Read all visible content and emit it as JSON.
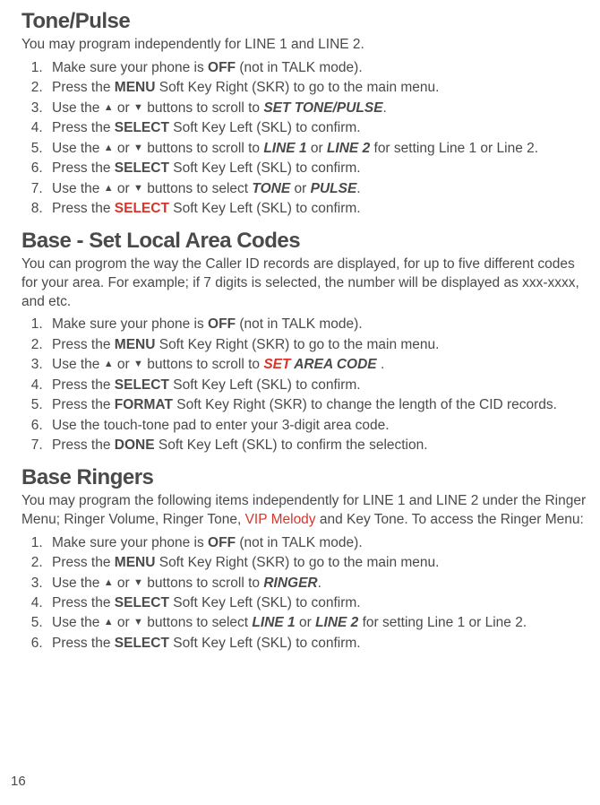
{
  "pageNumber": "16",
  "arrowUp": "▲",
  "arrowDown": "▼",
  "sections": {
    "tonePulse": {
      "title": "Tone/Pulse",
      "intro": "You may program independently for LINE  1 and LINE 2.",
      "steps": {
        "s1a": "Make sure your phone is ",
        "s1b": "OFF",
        "s1c": " (not in TALK mode).",
        "s2a": "Press the ",
        "s2b": "MENU",
        "s2c": " Soft Key Right (SKR) to go to the main menu.",
        "s3a": "Use the ",
        "s3b": " or ",
        "s3c": " buttons to scroll to ",
        "s3d": "SET TONE/PULSE",
        "s3e": ".",
        "s4a": "Press the ",
        "s4b": "SELECT",
        "s4c": " Soft Key Left (SKL) to confirm.",
        "s5a": "Use the ",
        "s5b": " or ",
        "s5c": " buttons to scroll to ",
        "s5d": "LINE 1",
        "s5e": " or ",
        "s5f": "LINE 2",
        "s5g": " for setting Line 1 or Line 2.",
        "s6a": "Press the ",
        "s6b": "SELECT",
        "s6c": " Soft Key Left (SKL) to confirm.",
        "s7a": "Use the ",
        "s7b": " or ",
        "s7c": " buttons to select ",
        "s7d": "TONE",
        "s7e": " or ",
        "s7f": "PULSE",
        "s7g": ".",
        "s8a": "Press the ",
        "s8b": "SELECT",
        "s8c": " Soft Key Left (SKL) to confirm."
      }
    },
    "areaCodes": {
      "title": "Base - Set Local Area Codes",
      "intro": "You can progrom the way the Caller ID records are displayed, for up to five different codes for your area. For example; if 7 digits is selected, the number will be displayed as xxx-xxxx, and etc.",
      "steps": {
        "s1a": "Make sure your phone is ",
        "s1b": "OFF",
        "s1c": " (not in TALK mode).",
        "s2a": "Press the ",
        "s2b": "MENU",
        "s2c": " Soft Key Right (SKR) to go to the main menu.",
        "s3a": "Use the ",
        "s3b": " or ",
        "s3c": " buttons to scroll to ",
        "s3d": "SET",
        "s3e": " AREA CODE",
        "s3f": " .",
        "s4a": "Press the ",
        "s4b": "SELECT",
        "s4c": " Soft Key Left (SKL) to confirm.",
        "s5a": "Press the ",
        "s5b": "FORMAT",
        "s5c": " Soft Key Right (SKR) to change the length of the CID records.",
        "s6": "Use the touch-tone pad to enter your 3-digit area code.",
        "s7a": "Press the ",
        "s7b": "DONE",
        "s7c": " Soft Key Left (SKL) to confirm the selection."
      }
    },
    "ringers": {
      "title": "Base Ringers",
      "introA": "You may program the following items independently for LINE  1 and LINE 2 under the Ringer Menu; Ringer Volume, Ringer Tone, ",
      "introB": "VIP Melody",
      "introC": " and Key Tone. To access the Ringer Menu:",
      "steps": {
        "s1a": "Make sure your phone is ",
        "s1b": "OFF",
        "s1c": " (not in TALK mode).",
        "s2a": "Press the ",
        "s2b": "MENU",
        "s2c": " Soft Key Right (SKR) to go to the main menu.",
        "s3a": "Use the ",
        "s3b": " or ",
        "s3c": " buttons to scroll to ",
        "s3d": "RINGER",
        "s3e": ".",
        "s4a": "Press the ",
        "s4b": "SELECT",
        "s4c": " Soft Key Left (SKL) to confirm.",
        "s5a": "Use the ",
        "s5b": " or ",
        "s5c": " buttons to select ",
        "s5d": "LINE 1",
        "s5e": " or ",
        "s5f": "LINE 2",
        "s5g": " for setting Line 1 or Line 2.",
        "s6a": "Press the ",
        "s6b": "SELECT",
        "s6c": " Soft Key Left (SKL) to confirm."
      }
    }
  }
}
